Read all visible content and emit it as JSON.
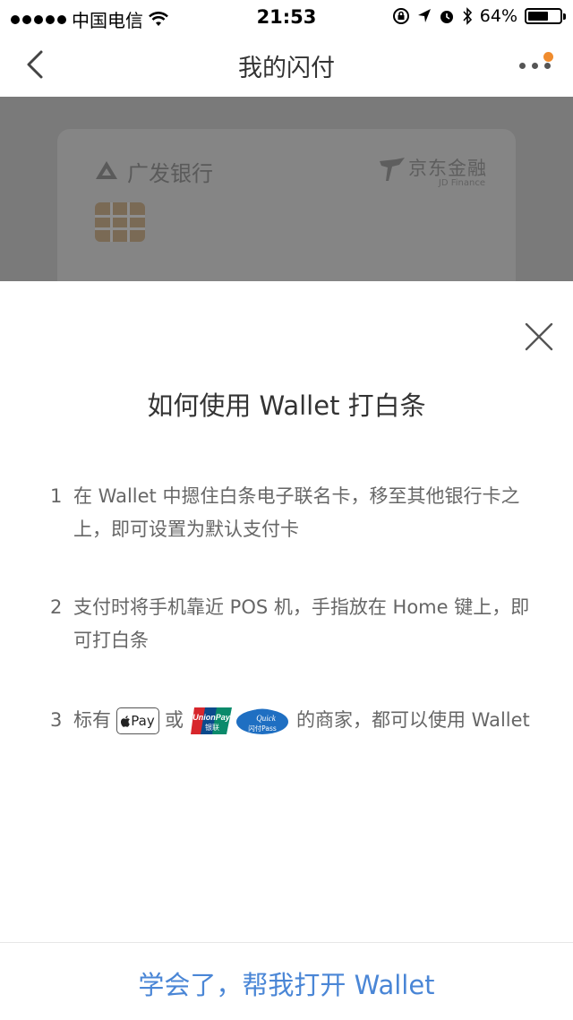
{
  "status_bar": {
    "carrier": "中国电信",
    "time": "21:53",
    "battery_percent": "64%",
    "battery_level": 0.64
  },
  "nav": {
    "title": "我的闪付",
    "badge_color": "#f08c2e"
  },
  "card": {
    "bank_name": "广发银行",
    "issuer_name": "京东金融",
    "issuer_sub": "JD Finance"
  },
  "sheet": {
    "title": "如何使用 Wallet 打白条",
    "steps": [
      {
        "num": "1",
        "text": "在 Wallet 中摁住白条电子联名卡，移至其他银行卡之上，即可设置为默认支付卡"
      },
      {
        "num": "2",
        "text": "支付时将手机靠近 POS 机，手指放在 Home 键上，即可打白条"
      },
      {
        "num": "3",
        "prefix": "标有",
        "applepay_label": "Pay",
        "or": "或",
        "unionpay_label": "UnionPay",
        "unionpay_cn": "银联",
        "quickpass_label": "Quick",
        "quickpass_cn": "闪付Pass",
        "suffix": "的商家，都可以使用 Wallet"
      }
    ],
    "cta": "学会了，帮我打开 Wallet",
    "cta_color": "#4a86d6"
  }
}
